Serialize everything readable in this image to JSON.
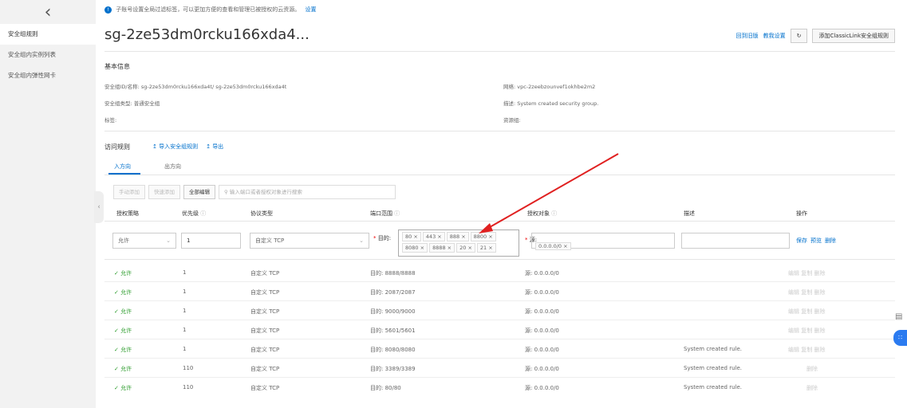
{
  "sidebar": {
    "back_icon": "chevron-left-icon",
    "items": [
      {
        "label": "安全组规则",
        "active": true
      },
      {
        "label": "安全组内实例列表",
        "active": false
      },
      {
        "label": "安全组内弹性网卡",
        "active": false
      }
    ]
  },
  "tip": {
    "text": "子账号设置全局过滤标签，可以更加方便的查看和管理已被授权的云资源。",
    "link": "设置"
  },
  "header": {
    "title": "sg-2ze53dm0rcku166xda4...",
    "back_label": "回到旧版",
    "tutorial_label": "教我设置",
    "refresh_icon": "refresh-icon",
    "add_classiclink_label": "添加ClassicLink安全组规则"
  },
  "basic_info": {
    "title": "基本信息",
    "id_name": "安全组ID/名称: sg-2ze53dm0rcku166xda4t/ sg-2ze53dm0rcku166xda4t",
    "type": "安全组类型: 普通安全组",
    "tags": "标签:",
    "network": "网络: vpc-2zeebzounvef1okhbe2m2",
    "description": "描述: System created security group.",
    "resource_group": "资源组:"
  },
  "rules": {
    "title": "访问规则",
    "import_label": "导入安全组规则",
    "export_label": "导出",
    "tabs": [
      "入方向",
      "出方向"
    ],
    "toolbar": {
      "manual_add": "手动添加",
      "quick_add": "快速添加",
      "edit_all": "全部编辑",
      "search_placeholder": "输入端口或者授权对象进行搜索"
    },
    "columns": [
      "授权策略",
      "优先级",
      "协议类型",
      "端口范围",
      "授权对象",
      "描述",
      "操作"
    ],
    "edit_row": {
      "policy": "允许",
      "priority": "1",
      "protocol": "自定义 TCP",
      "port_label": "目的:",
      "ports": [
        "80 ×",
        "443 ×",
        "888 ×",
        "8800 ×",
        "8080 ×",
        "8888 ×",
        "20 ×",
        "21 ×"
      ],
      "source_label": "源:",
      "source": "0.0.0.0/0 ×",
      "actions": [
        "保存",
        "预览",
        "删除"
      ]
    },
    "rows": [
      {
        "policy": "允许",
        "priority": "1",
        "protocol": "自定义 TCP",
        "port": "目的: 8888/8888",
        "source": "源: 0.0.0.0/0",
        "desc": "",
        "actions": "编辑 复制 删除"
      },
      {
        "policy": "允许",
        "priority": "1",
        "protocol": "自定义 TCP",
        "port": "目的: 2087/2087",
        "source": "源: 0.0.0.0/0",
        "desc": "",
        "actions": "编辑 复制 删除"
      },
      {
        "policy": "允许",
        "priority": "1",
        "protocol": "自定义 TCP",
        "port": "目的: 9000/9000",
        "source": "源: 0.0.0.0/0",
        "desc": "",
        "actions": "编辑 复制 删除"
      },
      {
        "policy": "允许",
        "priority": "1",
        "protocol": "自定义 TCP",
        "port": "目的: 5601/5601",
        "source": "源: 0.0.0.0/0",
        "desc": "",
        "actions": "编辑 复制 删除"
      },
      {
        "policy": "允许",
        "priority": "1",
        "protocol": "自定义 TCP",
        "port": "目的: 8080/8080",
        "source": "源: 0.0.0.0/0",
        "desc": "System created rule.",
        "actions": "编辑 复制 删除"
      },
      {
        "policy": "允许",
        "priority": "110",
        "protocol": "自定义 TCP",
        "port": "目的: 3389/3389",
        "source": "源: 0.0.0.0/0",
        "desc": "System created rule.",
        "actions": "删除"
      },
      {
        "policy": "允许",
        "priority": "110",
        "protocol": "自定义 TCP",
        "port": "目的: 80/80",
        "source": "源: 0.0.0.0/0",
        "desc": "System created rule.",
        "actions": "删除"
      }
    ]
  },
  "colors": {
    "accent": "#0070cc",
    "allow": "#2c9c2c",
    "annotation_arrow": "#e02020"
  }
}
